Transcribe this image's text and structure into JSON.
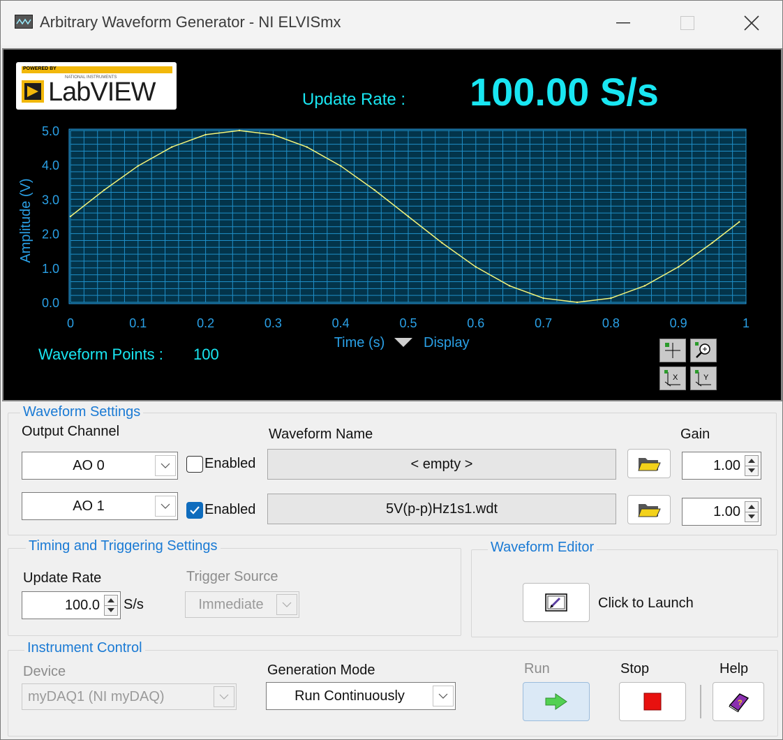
{
  "window": {
    "title": "Arbitrary Waveform Generator - NI ELVISmx"
  },
  "display": {
    "logo_text": "LabVIEW",
    "logo_small_1": "POWERED BY",
    "logo_small_2": "NATIONAL INSTRUMENTS",
    "update_rate_label": "Update Rate :",
    "update_rate_value": "100.00 S/s",
    "waveform_points_label": "Waveform Points :",
    "waveform_points_value": "100",
    "display_menu_label": "Display"
  },
  "chart_data": {
    "type": "line",
    "xlabel": "Time (s)",
    "ylabel": "Amplitude (V)",
    "xlim": [
      0,
      1
    ],
    "ylim": [
      0,
      5
    ],
    "x_ticks": [
      "0",
      "0.1",
      "0.2",
      "0.3",
      "0.4",
      "0.5",
      "0.6",
      "0.7",
      "0.8",
      "0.9",
      "1"
    ],
    "y_ticks": [
      "0.0",
      "1.0",
      "2.0",
      "3.0",
      "4.0",
      "5.0"
    ],
    "grid": true,
    "line_color": "#f5f57a",
    "series": [
      {
        "x": [
          0,
          0.05,
          0.1,
          0.15,
          0.2,
          0.25,
          0.3,
          0.35,
          0.4,
          0.45,
          0.5,
          0.55,
          0.6,
          0.65,
          0.7,
          0.75,
          0.8,
          0.85,
          0.9,
          0.95,
          0.99
        ],
        "values": [
          2.5,
          3.27,
          3.97,
          4.52,
          4.88,
          5.0,
          4.88,
          4.52,
          3.97,
          3.27,
          2.5,
          1.73,
          1.03,
          0.48,
          0.12,
          0.0,
          0.12,
          0.48,
          1.03,
          1.73,
          2.34
        ]
      }
    ]
  },
  "waveform_settings": {
    "title": "Waveform Settings",
    "output_channel_label": "Output Channel",
    "waveform_name_label": "Waveform Name",
    "gain_label": "Gain",
    "rows": [
      {
        "channel": "AO 0",
        "enabled_label": "Enabled",
        "enabled": false,
        "waveform_name": "< empty >",
        "gain": "1.00"
      },
      {
        "channel": "AO 1",
        "enabled_label": "Enabled",
        "enabled": true,
        "waveform_name": "5V(p-p)Hz1s1.wdt",
        "gain": "1.00"
      }
    ]
  },
  "timing": {
    "title": "Timing and Triggering Settings",
    "update_rate_label": "Update Rate",
    "update_rate_value": "100.0",
    "update_rate_unit": "S/s",
    "trigger_source_label": "Trigger Source",
    "trigger_source_value": "Immediate"
  },
  "editor": {
    "title": "Waveform Editor",
    "launch_label": "Click to Launch"
  },
  "instrument": {
    "title": "Instrument Control",
    "device_label": "Device",
    "device_value": "myDAQ1 (NI myDAQ)",
    "generation_mode_label": "Generation Mode",
    "generation_mode_value": "Run Continuously",
    "run_label": "Run",
    "stop_label": "Stop",
    "help_label": "Help"
  }
}
